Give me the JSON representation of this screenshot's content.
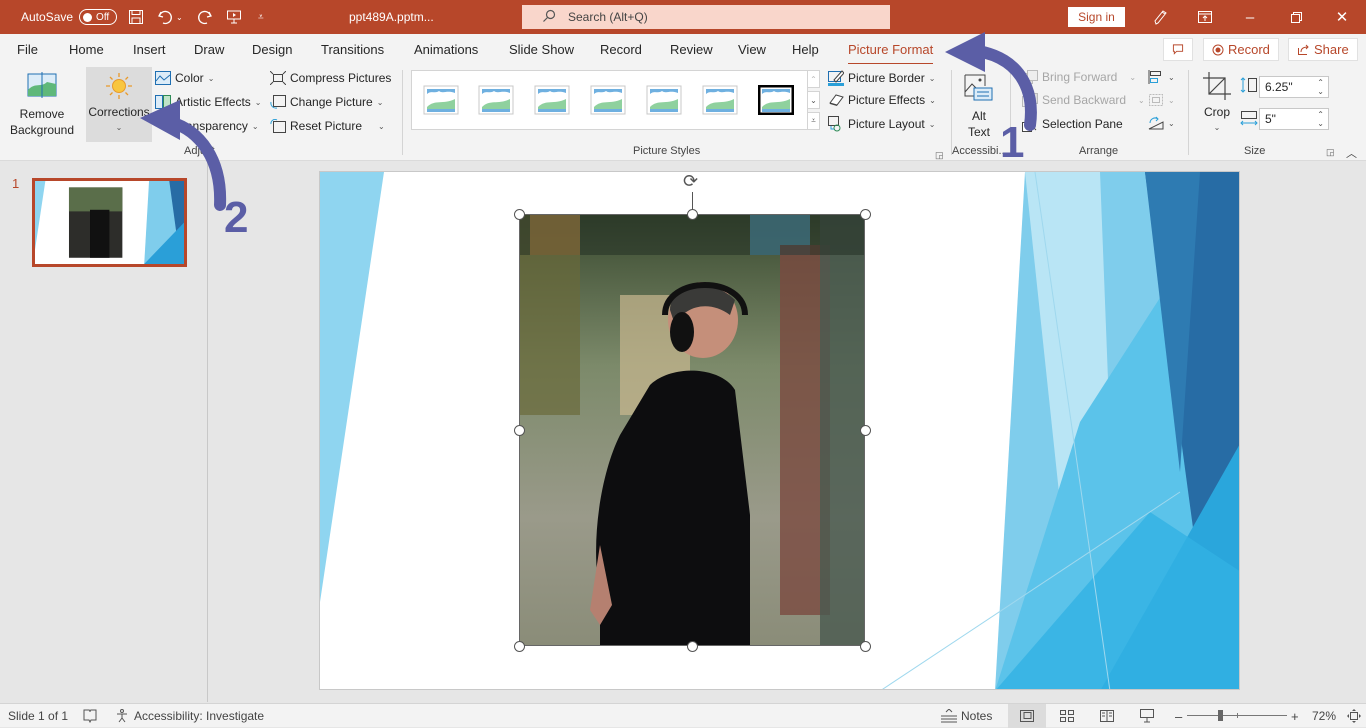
{
  "titlebar": {
    "autosave_label": "AutoSave",
    "autosave_state": "Off",
    "filename": "ppt489A.pptm...",
    "search_placeholder": "Search (Alt+Q)",
    "signin_label": "Sign in",
    "icons": [
      "save-icon",
      "undo-icon",
      "redo-icon",
      "present-icon",
      "customize-icon",
      "pen-icon",
      "ribbon-display-icon",
      "minimize-icon",
      "restore-icon",
      "close-icon"
    ]
  },
  "tabs": [
    "File",
    "Home",
    "Insert",
    "Draw",
    "Design",
    "Transitions",
    "Animations",
    "Slide Show",
    "Record",
    "Review",
    "View",
    "Help",
    "Picture Format"
  ],
  "active_tab": "Picture Format",
  "tab_buttons": {
    "comments": "",
    "record": "Record",
    "share": "Share"
  },
  "ribbon": {
    "adjust": {
      "remove_background": [
        "Remove",
        "Background"
      ],
      "corrections": "Corrections",
      "color": "Color",
      "artistic_effects": "Artistic Effects",
      "transparency": "Transparency",
      "compress": "Compress Pictures",
      "change_picture": "Change Picture",
      "reset_picture": "Reset Picture",
      "group_label": "Adjust"
    },
    "styles": {
      "group_label": "Picture Styles",
      "picture_border": "Picture Border",
      "picture_effects": "Picture Effects",
      "picture_layout": "Picture Layout",
      "gallery_count": 7
    },
    "accessibility": {
      "alt_text": [
        "Alt",
        "Text"
      ],
      "group_label": "Accessibi..."
    },
    "arrange": {
      "bring_forward": "Bring Forward",
      "send_backward": "Send Backward",
      "selection_pane": "Selection Pane",
      "group_label": "Arrange"
    },
    "size": {
      "crop": "Crop",
      "height": "6.25\"",
      "width": "5\"",
      "group_label": "Size"
    }
  },
  "slides_pane": {
    "slide_number": "1"
  },
  "annotations": {
    "arrow1_label": "1",
    "arrow2_label": "2",
    "color": "#5b5ea6"
  },
  "statusbar": {
    "slide_info": "Slide 1 of 1",
    "accessibility": "Accessibility: Investigate",
    "notes": "Notes",
    "zoom": "72%",
    "zoom_level": 0.72
  },
  "colors": {
    "accent": "#b7472a",
    "slide_light_blue": "#8fd5f0",
    "slide_blue": "#2a9fd8",
    "slide_dark_blue": "#276ca5"
  }
}
